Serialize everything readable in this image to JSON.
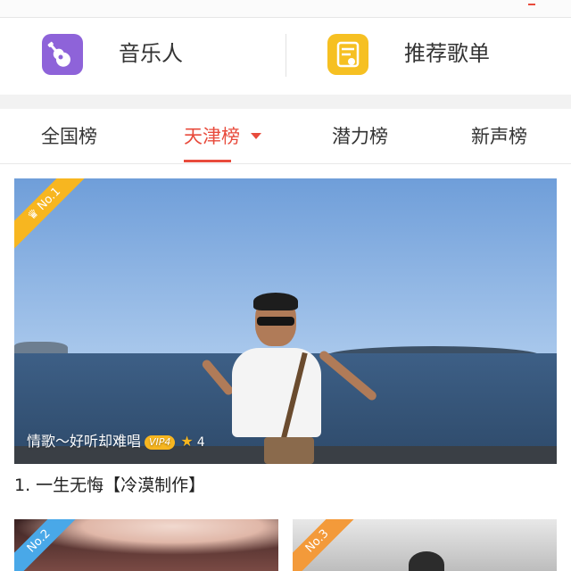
{
  "shortcuts": [
    {
      "label": "音乐人",
      "icon": "guitar-icon"
    },
    {
      "label": "推荐歌单",
      "icon": "playlist-icon"
    }
  ],
  "tabs": [
    {
      "label": "全国榜",
      "active": false
    },
    {
      "label": "天津榜",
      "active": true,
      "dropdown": true
    },
    {
      "label": "潜力榜",
      "active": false
    },
    {
      "label": "新声榜",
      "active": false
    }
  ],
  "cards": [
    {
      "rank_badge": "No.1",
      "song_title": "情歌～好听却难唱",
      "vip_level": "VIP4",
      "star_count": "4",
      "title": "1. 一生无悔【冷漠制作】"
    },
    {
      "rank_badge": "No.2"
    },
    {
      "rank_badge": "No.3"
    }
  ],
  "colors": {
    "accent": "#e84b3c",
    "badge_gold": "#f7b620",
    "badge_blue": "#49a8e8",
    "badge_orange": "#f39a3a",
    "musician_icon_bg": "#8e63d9",
    "playlist_icon_bg": "#f6c022"
  }
}
